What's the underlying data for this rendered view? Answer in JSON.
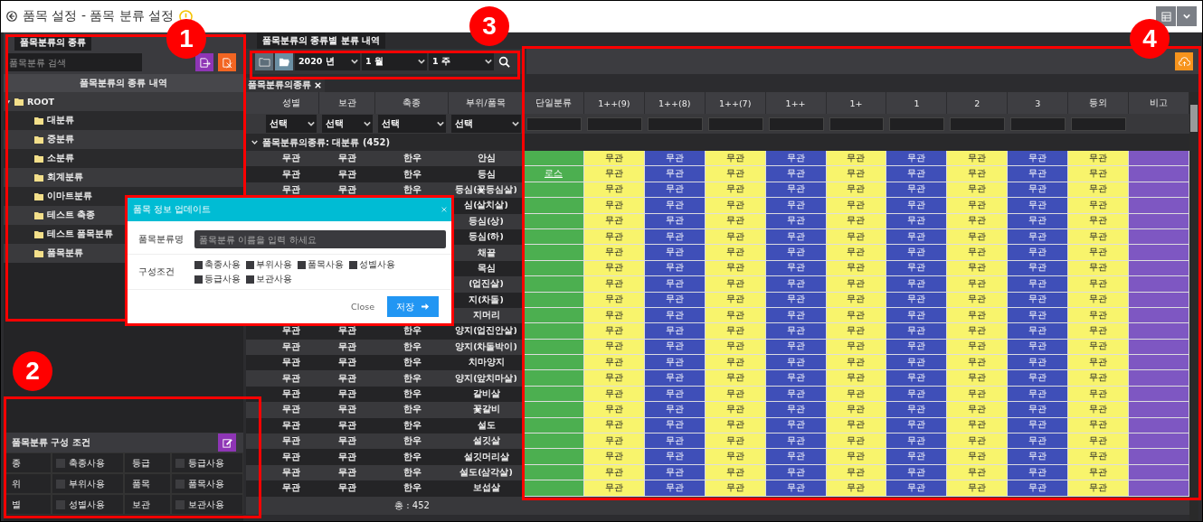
{
  "title": "품목 설정 - 품목 분류 설정",
  "left_tab": "품목분류의 종류",
  "search": {
    "placeholder": "품목분류 검색"
  },
  "tree_header": "품목분류의 종류 내역",
  "tree": [
    {
      "label": "ROOT",
      "expanded": true,
      "children": [
        {
          "label": "대분류"
        },
        {
          "label": "중분류"
        },
        {
          "label": "소분류"
        },
        {
          "label": "회계분류"
        },
        {
          "label": "이마트분류"
        },
        {
          "label": "테스트 축종"
        },
        {
          "label": "테스트 품목분류"
        },
        {
          "label": "품목분류"
        }
      ]
    }
  ],
  "conditions": {
    "title": "품목분류 구성 조건",
    "items": [
      {
        "label": "종",
        "option": "축종사용",
        "checked": false
      },
      {
        "label": "등급",
        "option": "등급사용",
        "checked": false
      },
      {
        "label": "위",
        "option": "부위사용",
        "checked": false
      },
      {
        "label": "품목",
        "option": "품목사용",
        "checked": false
      },
      {
        "label": "별",
        "option": "성별사용",
        "checked": false
      },
      {
        "label": "보관",
        "option": "보관사용",
        "checked": false
      }
    ]
  },
  "main_tab": "품목분류의 종류별 분류 내역",
  "period": [
    "2020 년",
    "1 월",
    "1 주"
  ],
  "group_chip": "품목분류의종류",
  "columns": [
    "성별",
    "보관",
    "축종",
    "부위/품목"
  ],
  "filters": [
    "선택",
    "선택",
    "선택",
    "선택"
  ],
  "single_column": {
    "label": "단일분류",
    "color": "#4caf50"
  },
  "grade_columns": [
    {
      "label": "1++(9)",
      "color": "#f8f46c"
    },
    {
      "label": "1++(8)",
      "color": "#3f4fb8"
    },
    {
      "label": "1++(7)",
      "color": "#f8f46c"
    },
    {
      "label": "1++",
      "color": "#3f4fb8"
    },
    {
      "label": "1+",
      "color": "#f8f46c"
    },
    {
      "label": "1",
      "color": "#3f4fb8"
    },
    {
      "label": "2",
      "color": "#f8f46c"
    },
    {
      "label": "3",
      "color": "#3f4fb8"
    },
    {
      "label": "등외",
      "color": "#f8f46c"
    }
  ],
  "note_column": {
    "label": "비고",
    "color": "#7e57c2"
  },
  "group": {
    "label": "품목분류의종류: 대분류 (452)",
    "expanded": true
  },
  "rows": [
    {
      "sex": "무관",
      "storage": "무관",
      "species": "한우",
      "part": "안심",
      "grades": [
        "무관",
        "무관",
        "무관",
        "무관",
        "무관",
        "무관",
        "무관",
        "무관",
        "무관"
      ]
    },
    {
      "sex": "무관",
      "storage": "무관",
      "species": "한우",
      "part": "등심",
      "single": "로스",
      "grades": [
        "무관",
        "무관",
        "무관",
        "무관",
        "무관",
        "무관",
        "무관",
        "무관",
        "무관"
      ]
    },
    {
      "sex": "무관",
      "storage": "무관",
      "species": "한우",
      "part": "등심(꽃등심살)",
      "grades": [
        "무관",
        "무관",
        "무관",
        "무관",
        "무관",
        "무관",
        "무관",
        "무관",
        "무관"
      ]
    },
    {
      "part": "심(살치살)",
      "grades": [
        "무관",
        "무관",
        "무관",
        "무관",
        "무관",
        "무관",
        "무관",
        "무관",
        "무관"
      ]
    },
    {
      "part": "등심(상)",
      "grades": [
        "무관",
        "무관",
        "무관",
        "무관",
        "무관",
        "무관",
        "무관",
        "무관",
        "무관"
      ]
    },
    {
      "part": "등심(하)",
      "grades": [
        "무관",
        "무관",
        "무관",
        "무관",
        "무관",
        "무관",
        "무관",
        "무관",
        "무관"
      ]
    },
    {
      "part": "채끝",
      "grades": [
        "무관",
        "무관",
        "무관",
        "무관",
        "무관",
        "무관",
        "무관",
        "무관",
        "무관"
      ]
    },
    {
      "part": "목심",
      "grades": [
        "무관",
        "무관",
        "무관",
        "무관",
        "무관",
        "무관",
        "무관",
        "무관",
        "무관"
      ]
    },
    {
      "part": "(업진살)",
      "grades": [
        "무관",
        "무관",
        "무관",
        "무관",
        "무관",
        "무관",
        "무관",
        "무관",
        "무관"
      ]
    },
    {
      "part": "지(차돌)",
      "grades": [
        "무관",
        "무관",
        "무관",
        "무관",
        "무관",
        "무관",
        "무관",
        "무관",
        "무관"
      ]
    },
    {
      "part": "지머리",
      "grades": [
        "무관",
        "무관",
        "무관",
        "무관",
        "무관",
        "무관",
        "무관",
        "무관",
        "무관"
      ]
    },
    {
      "sex": "무관",
      "storage": "무관",
      "species": "한우",
      "part": "양지(업진안살)",
      "grades": [
        "무관",
        "무관",
        "무관",
        "무관",
        "무관",
        "무관",
        "무관",
        "무관",
        "무관"
      ]
    },
    {
      "sex": "무관",
      "storage": "무관",
      "species": "한우",
      "part": "양지(차돌박이)",
      "grades": [
        "무관",
        "무관",
        "무관",
        "무관",
        "무관",
        "무관",
        "무관",
        "무관",
        "무관"
      ]
    },
    {
      "sex": "무관",
      "storage": "무관",
      "species": "한우",
      "part": "치마양지",
      "grades": [
        "무관",
        "무관",
        "무관",
        "무관",
        "무관",
        "무관",
        "무관",
        "무관",
        "무관"
      ]
    },
    {
      "sex": "무관",
      "storage": "무관",
      "species": "한우",
      "part": "양지(앞치마살)",
      "grades": [
        "무관",
        "무관",
        "무관",
        "무관",
        "무관",
        "무관",
        "무관",
        "무관",
        "무관"
      ]
    },
    {
      "sex": "무관",
      "storage": "무관",
      "species": "한우",
      "part": "갈비살",
      "grades": [
        "무관",
        "무관",
        "무관",
        "무관",
        "무관",
        "무관",
        "무관",
        "무관",
        "무관"
      ]
    },
    {
      "sex": "무관",
      "storage": "무관",
      "species": "한우",
      "part": "꽃갈비",
      "grades": [
        "무관",
        "무관",
        "무관",
        "무관",
        "무관",
        "무관",
        "무관",
        "무관",
        "무관"
      ]
    },
    {
      "sex": "무관",
      "storage": "무관",
      "species": "한우",
      "part": "설도",
      "grades": [
        "무관",
        "무관",
        "무관",
        "무관",
        "무관",
        "무관",
        "무관",
        "무관",
        "무관"
      ]
    },
    {
      "sex": "무관",
      "storage": "무관",
      "species": "한우",
      "part": "설깃살",
      "grades": [
        "무관",
        "무관",
        "무관",
        "무관",
        "무관",
        "무관",
        "무관",
        "무관",
        "무관"
      ]
    },
    {
      "sex": "무관",
      "storage": "무관",
      "species": "한우",
      "part": "설깃머리살",
      "grades": [
        "무관",
        "무관",
        "무관",
        "무관",
        "무관",
        "무관",
        "무관",
        "무관",
        "무관"
      ]
    },
    {
      "sex": "무관",
      "storage": "무관",
      "species": "한우",
      "part": "설도(삼각살)",
      "grades": [
        "무관",
        "무관",
        "무관",
        "무관",
        "무관",
        "무관",
        "무관",
        "무관",
        "무관"
      ]
    },
    {
      "sex": "무관",
      "storage": "무관",
      "species": "한우",
      "part": "보섭살",
      "grades": [
        "무관",
        "무관",
        "무관",
        "무관",
        "무관",
        "무관",
        "무관",
        "무관",
        "무관"
      ]
    }
  ],
  "total": "총 : 452",
  "dialog": {
    "title": "품목 정보 업데이트",
    "name_label": "품목분류명",
    "name_placeholder": "품목분류 이름을 입력 하세요",
    "options_label": "구성조건",
    "options": [
      {
        "label": "축종사용",
        "checked": false
      },
      {
        "label": "부위사용",
        "checked": false
      },
      {
        "label": "품목사용",
        "checked": false
      },
      {
        "label": "성별사용",
        "checked": false
      },
      {
        "label": "등급사용",
        "checked": false
      },
      {
        "label": "보관사용",
        "checked": false
      }
    ],
    "close": "Close",
    "save": "저장"
  },
  "annotations": [
    {
      "label": "1"
    },
    {
      "label": "2"
    },
    {
      "label": "3"
    },
    {
      "label": "4"
    }
  ]
}
